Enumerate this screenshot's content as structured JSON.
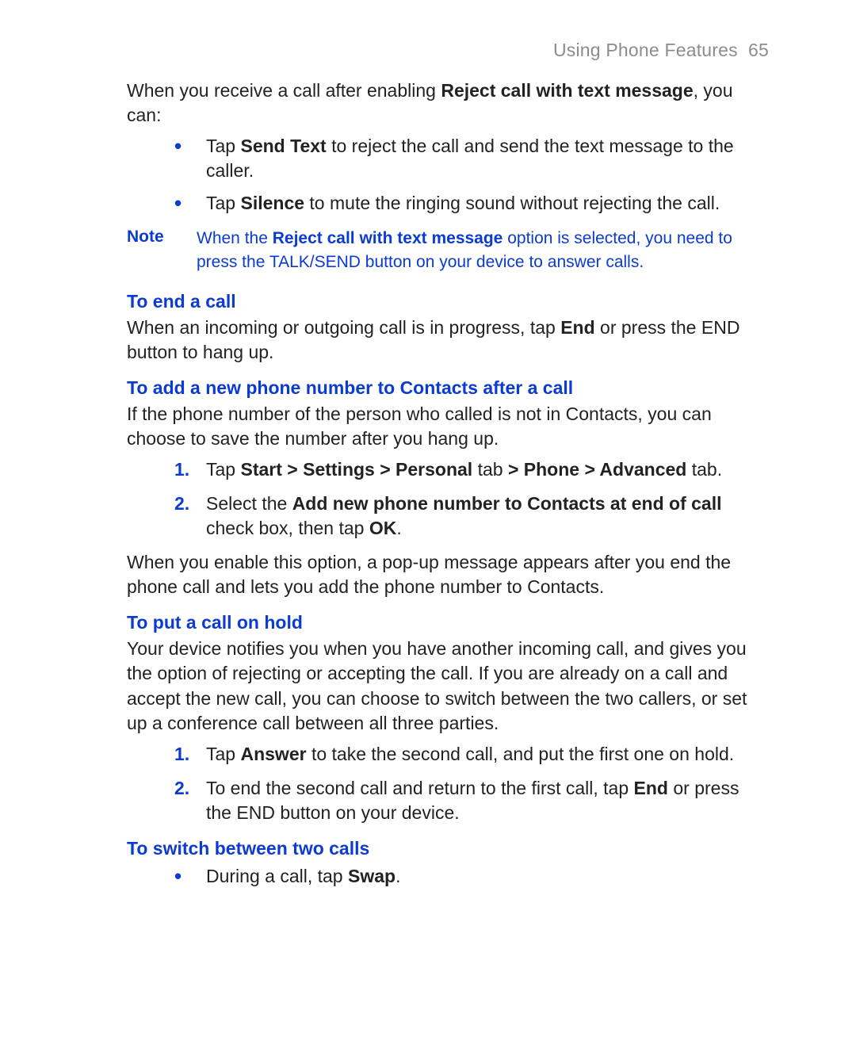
{
  "header": {
    "section": "Using Phone Features",
    "page": "65"
  },
  "intro": {
    "pre": "When you receive a call after enabling ",
    "bold": "Reject call with text message",
    "post": ", you can:"
  },
  "introBullets": [
    {
      "pre": "Tap ",
      "bold": "Send Text",
      "post": " to reject the call and send the text message to the caller."
    },
    {
      "pre": "Tap ",
      "bold": "Silence",
      "post": " to mute the ringing sound without rejecting the call."
    }
  ],
  "note": {
    "label": "Note",
    "pre": "When the ",
    "bold": "Reject call with text message",
    "post": " option is selected, you need to press the TALK/SEND button on your device to answer calls."
  },
  "endCall": {
    "heading": "To end a call",
    "pre": "When an incoming or outgoing call is in progress, tap ",
    "bold": "End",
    "post": " or press the END button to hang up."
  },
  "addContact": {
    "heading": "To add a new phone number to Contacts after a call",
    "intro": "If the phone number of the person who called is not in Contacts, you can choose to save the number after you hang up.",
    "step1": {
      "pre": "Tap ",
      "b1": "Start > Settings > Personal",
      "mid1": " tab ",
      "b2": "> Phone > Advanced",
      "post": " tab."
    },
    "step2": {
      "pre": "Select the ",
      "b1": "Add new phone number to Contacts at end of call",
      "mid1": " check box, then tap ",
      "b2": "OK",
      "post": "."
    },
    "after": "When you enable this option, a pop-up message appears after you end the phone call and lets you add the phone number to Contacts."
  },
  "hold": {
    "heading": "To put a call on hold",
    "intro": "Your device notifies you when you have another incoming call, and gives you the option of rejecting or accepting the call. If you are already on a call and accept the new call, you can choose to switch between the two callers, or set up a conference call between all three parties.",
    "step1": {
      "pre": "Tap ",
      "bold": "Answer",
      "post": " to take the second call, and put the first one on hold."
    },
    "step2": {
      "pre": "To end the second call and return to the first call, tap ",
      "bold": "End",
      "post": " or press the END button on your device."
    }
  },
  "switch": {
    "heading": "To switch between two calls",
    "bullet": {
      "pre": "During a call, tap ",
      "bold": "Swap",
      "post": "."
    }
  }
}
